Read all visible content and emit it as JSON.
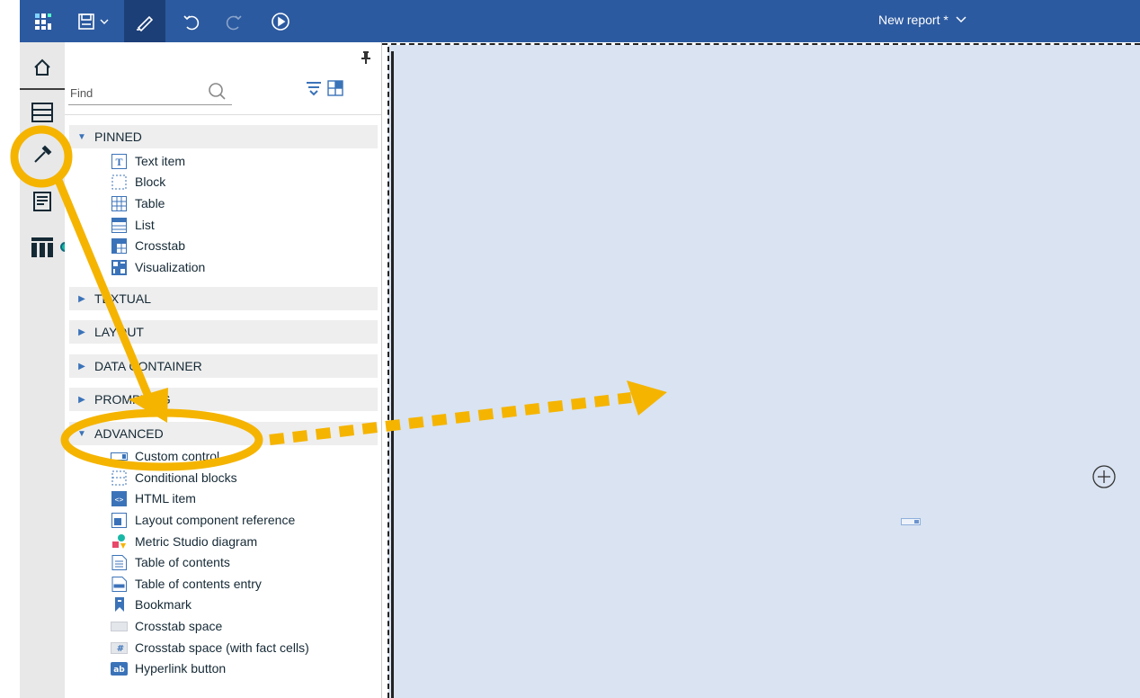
{
  "topbar": {
    "report_title": "New report *",
    "icons": [
      "app-grid-icon",
      "save-icon",
      "chevron-down-icon",
      "edit-pencil-icon",
      "undo-icon",
      "redo-icon",
      "run-play-icon"
    ]
  },
  "leftrail": {
    "items": [
      "home-icon",
      "data-source-icon",
      "toolbox-hammer-icon",
      "pages-icon",
      "query-table-icon"
    ]
  },
  "panel": {
    "find_placeholder": "Find",
    "sections": [
      {
        "label": "PINNED",
        "expanded": true
      },
      {
        "label": "TEXTUAL",
        "expanded": false
      },
      {
        "label": "LAYOUT",
        "expanded": false
      },
      {
        "label": "DATA CONTAINER",
        "expanded": false
      },
      {
        "label": "PROMPTING",
        "expanded": false
      },
      {
        "label": "ADVANCED",
        "expanded": true
      }
    ],
    "pinned_items": [
      "Text item",
      "Block",
      "Table",
      "List",
      "Crosstab",
      "Visualization"
    ],
    "advanced_items": [
      "Custom control",
      "Conditional blocks",
      "HTML item",
      "Layout component reference",
      "Metric Studio diagram",
      "Table of contents",
      "Table of contents entry",
      "Bookmark",
      "Crosstab space",
      "Crosstab space (with fact cells)",
      "Hyperlink button"
    ]
  },
  "colors": {
    "topbar": "#2c5aa0",
    "canvas": "#d9e3f1",
    "annotation": "#f5b400",
    "accent": "#3b73b9"
  }
}
